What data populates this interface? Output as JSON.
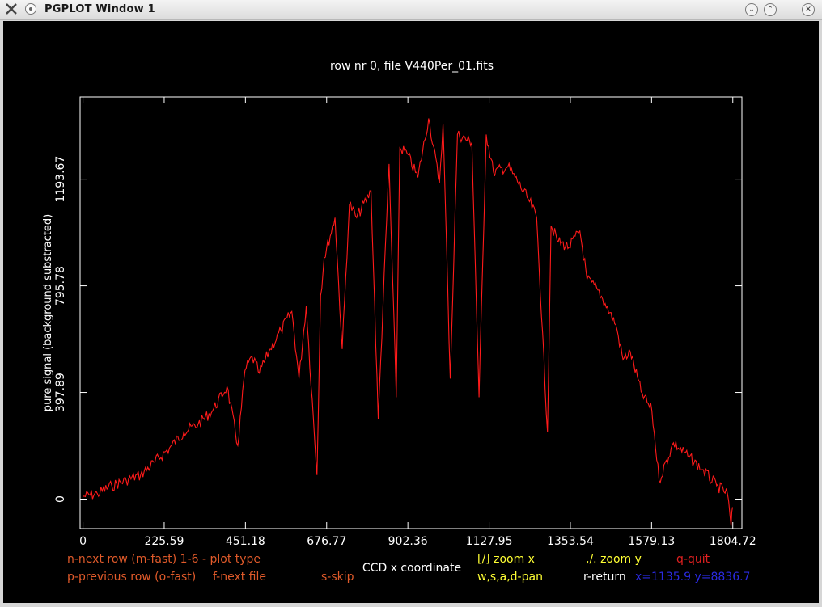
{
  "window": {
    "title": "PGPLOT Window 1",
    "buttons": {
      "minimize": "⌄",
      "maximize": "⌃",
      "close": "✕"
    }
  },
  "plot_title": "row nr 0, file V440Per_01.fits",
  "xlabel": "CCD x coordinate",
  "ylabel": "pure signal (background substracted)",
  "xticks": [
    "0",
    "225.59",
    "451.18",
    "676.77",
    "902.36",
    "1127.95",
    "1353.54",
    "1579.13",
    "1804.72"
  ],
  "yticks": [
    "0",
    "397.89",
    "795.78",
    "1193.67"
  ],
  "help": {
    "next_row": "n-next row (m-fast) 1-6 - plot type",
    "prev_row": "p-previous row (o-fast)",
    "next_file": "f-next file",
    "skip": "s-skip",
    "zoom_x": "[/] zoom x",
    "zoom_y": ",/. zoom y",
    "quit": "q-quit",
    "pan": "w,s,a,d-pan",
    "return": "r-return",
    "coords": "x=1135.9  y=8836.7"
  },
  "colors": {
    "line": "#ff1a1a",
    "background": "#000000",
    "axes": "#ffffff",
    "help_orange": "#e05a2a",
    "help_yellow": "#ffff33",
    "help_red": "#e02020",
    "help_blue": "#2a2ae0"
  },
  "chart_data": {
    "type": "line",
    "xlabel": "CCD x coordinate",
    "ylabel": "pure signal (background substracted)",
    "xlim": [
      -8,
      1830
    ],
    "ylim": [
      -110,
      1500
    ],
    "series": [
      {
        "x": [
          0,
          40,
          80,
          120,
          160,
          200,
          240,
          280,
          320,
          360,
          400,
          430,
          450,
          470,
          490,
          520,
          550,
          580,
          600,
          620,
          650,
          660,
          670,
          700,
          720,
          740,
          760,
          800,
          820,
          850,
          870,
          880,
          900,
          930,
          960,
          990,
          1000,
          1020,
          1040,
          1080,
          1100,
          1120,
          1140,
          1180,
          1200,
          1240,
          1260,
          1290,
          1300,
          1320,
          1350,
          1380,
          1400,
          1430,
          1450,
          1480,
          1500,
          1520,
          1550,
          1580,
          1600,
          1640,
          1680,
          1720,
          1760,
          1790,
          1800,
          1804
        ],
        "y": [
          10,
          20,
          50,
          70,
          90,
          140,
          190,
          250,
          280,
          330,
          420,
          200,
          480,
          530,
          470,
          560,
          630,
          700,
          450,
          720,
          90,
          760,
          900,
          1050,
          560,
          1100,
          1050,
          1150,
          300,
          1250,
          380,
          1310,
          1290,
          1200,
          1420,
          1180,
          1400,
          450,
          1360,
          1330,
          380,
          1360,
          1220,
          1240,
          1200,
          1110,
          1050,
          250,
          1020,
          960,
          940,
          1000,
          820,
          780,
          730,
          650,
          520,
          550,
          400,
          330,
          70,
          210,
          160,
          110,
          50,
          20,
          -100,
          -30
        ]
      }
    ]
  }
}
